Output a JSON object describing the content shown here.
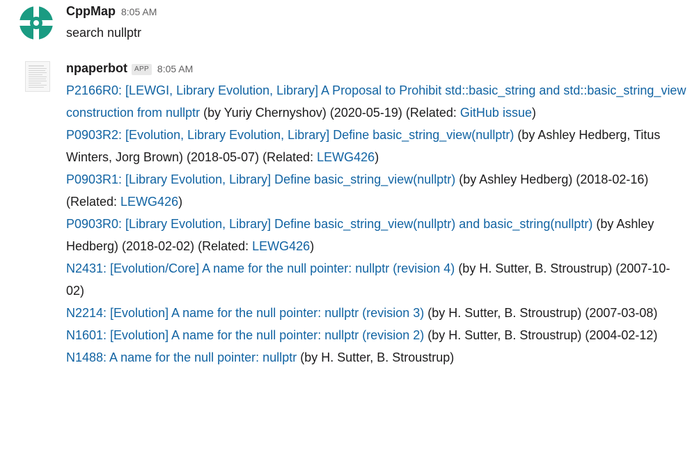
{
  "messages": [
    {
      "sender": "CppMap",
      "time": "8:05 AM",
      "avatar_icon": "cppmap-logo-icon",
      "avatar_color": "#1a9b82",
      "text": "search nullptr"
    },
    {
      "sender": "npaperbot",
      "badge": "APP",
      "time": "8:05 AM",
      "avatar_icon": "document-thumbnail-icon",
      "results": [
        {
          "title": "P2166R0: [LEWGI, Library Evolution, Library] A Proposal to Prohibit std::basic_string and std::basic_string_view construction from nullptr",
          "details": " (by Yuriy Chernyshov) (2020-05-19) (Related: ",
          "related": "GitHub issue",
          "close": ")"
        },
        {
          "title": "P0903R2: [Evolution, Library Evolution, Library] Define basic_string_view(nullptr)",
          "details": " (by Ashley Hedberg, Titus Winters, Jorg Brown) (2018-05-07) (Related: ",
          "related": "LEWG426",
          "close": ")"
        },
        {
          "title": "P0903R1: [Library Evolution, Library] Define basic_string_view(nullptr)",
          "details": " (by Ashley Hedberg) (2018-02-16) (Related: ",
          "related": "LEWG426",
          "close": ")"
        },
        {
          "title": "P0903R0: [Library Evolution, Library] Define basic_string_view(nullptr) and basic_string(nullptr)",
          "details": " (by Ashley Hedberg) (2018-02-02) (Related: ",
          "related": "LEWG426",
          "close": ")"
        },
        {
          "title": "N2431: [Evolution/Core] A name for the null pointer: nullptr (revision 4)",
          "details": " (by H. Sutter, B. Stroustrup) (2007-10-02)"
        },
        {
          "title": "N2214: [Evolution] A name for the null pointer: nullptr (revision 3)",
          "details": " (by H. Sutter, B. Stroustrup) (2007-03-08)"
        },
        {
          "title": "N1601: [Evolution] A name for the null pointer: nullptr (revision 2)",
          "details": " (by H. Sutter, B. Stroustrup) (2004-02-12)"
        },
        {
          "title": "N1488: A name for the null pointer: nullptr",
          "details": " (by H. Sutter, B. Stroustrup)"
        }
      ]
    }
  ],
  "colors": {
    "link": "#1264a3",
    "text": "#1d1c1d",
    "muted": "#616061"
  }
}
